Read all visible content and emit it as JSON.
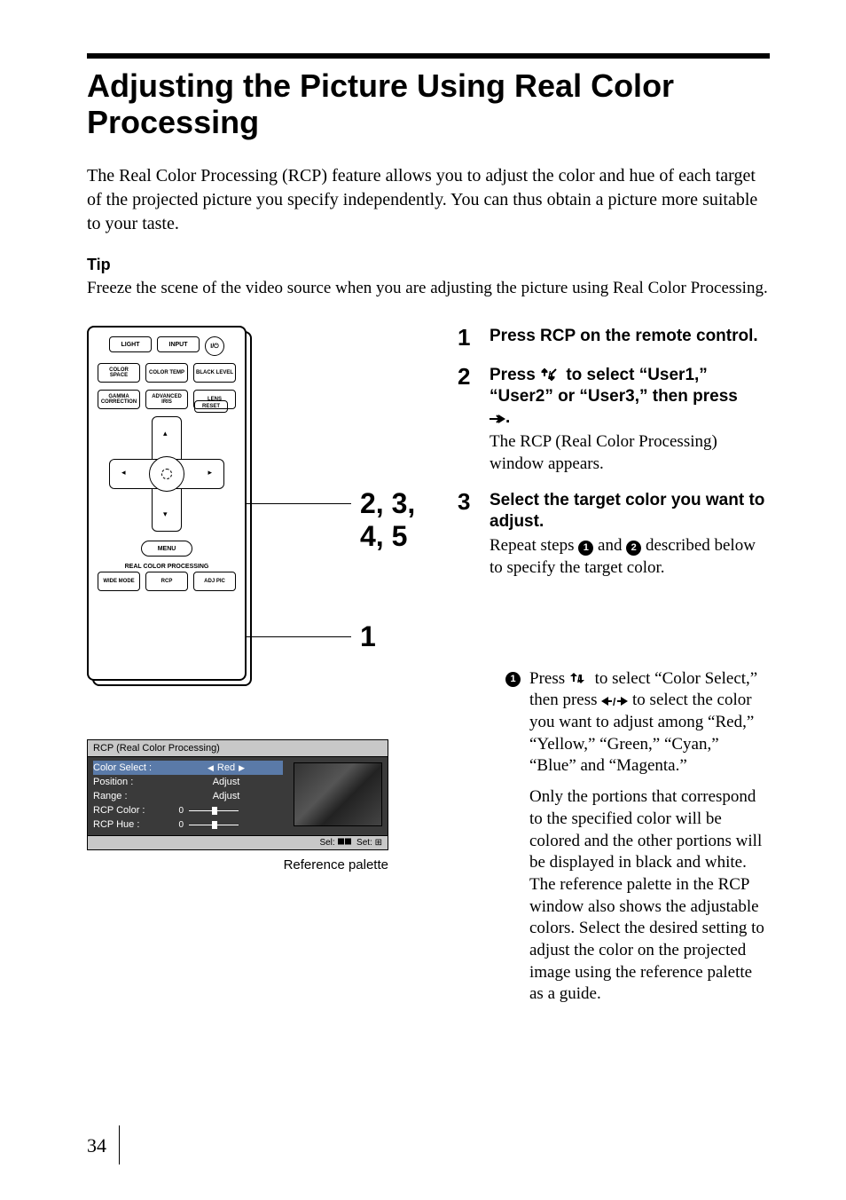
{
  "title": "Adjusting the Picture Using Real Color Processing",
  "intro": "The Real Color Processing (RCP) feature allows you to adjust the color and hue of each target of the projected picture you specify independently. You can thus obtain a picture more suitable to your taste.",
  "tip": {
    "label": "Tip",
    "body": "Freeze the scene of the video source when you are adjusting the picture using Real Color Processing."
  },
  "remote": {
    "buttons": {
      "light": "LIGHT",
      "input": "INPUT",
      "power": "I/♨",
      "color_space": "COLOR\nSPACE",
      "color_temp": "COLOR\nTEMP",
      "black_level": "BLACK\nLEVEL",
      "gamma": "GAMMA\nCORRECTION",
      "adv_iris": "ADVANCED\nIRIS",
      "lens": "LENS",
      "reset": "RESET",
      "menu": "MENU",
      "section": "REAL COLOR PROCESSING",
      "wide_mode": "WIDE\nMODE",
      "rcp": "RCP",
      "adj_pic": "ADJ PIC"
    },
    "callout_steps": "2, 3, 4, 5",
    "callout_rcp": "1"
  },
  "rcp_window": {
    "title": "RCP (Real Color Processing)",
    "rows": {
      "color_select": {
        "label": "Color Select :",
        "value": "Red"
      },
      "position": {
        "label": "Position :",
        "value": "Adjust"
      },
      "range": {
        "label": "Range :",
        "value": "Adjust"
      },
      "rcp_color": {
        "label": "RCP Color :",
        "value": "0"
      },
      "rcp_hue": {
        "label": "RCP Hue :",
        "value": "0"
      }
    },
    "footer_sel": "Sel:",
    "footer_set": "Set:",
    "caption": "Reference palette"
  },
  "steps": {
    "s1": {
      "num": "1",
      "head": "Press RCP on the remote control."
    },
    "s2": {
      "num": "2",
      "head_a": "Press ",
      "head_b": " to select “User1,” “User2” or “User3,” then press ",
      "head_c": ".",
      "body": "The RCP (Real Color Processing) window appears."
    },
    "s3": {
      "num": "3",
      "head": "Select the target color you want to adjust.",
      "body_a": "Repeat steps ",
      "body_b": " and ",
      "body_c": " described below to specify the target color."
    }
  },
  "substeps": {
    "a": {
      "num": "1",
      "t1": "Press ",
      "t2": " to select “Color Select,” then press ",
      "t3": " to select the color you want to adjust among “Red,” “Yellow,” “Green,” “Cyan,” “Blue” and “Magenta.”",
      "t4": "Only the portions that correspond to the specified color will be colored and the other portions will be displayed in black and white. The reference palette in the RCP window also shows the adjustable colors. Select the desired setting to adjust the color on the projected image using the reference palette as a guide."
    }
  },
  "page_number": "34"
}
